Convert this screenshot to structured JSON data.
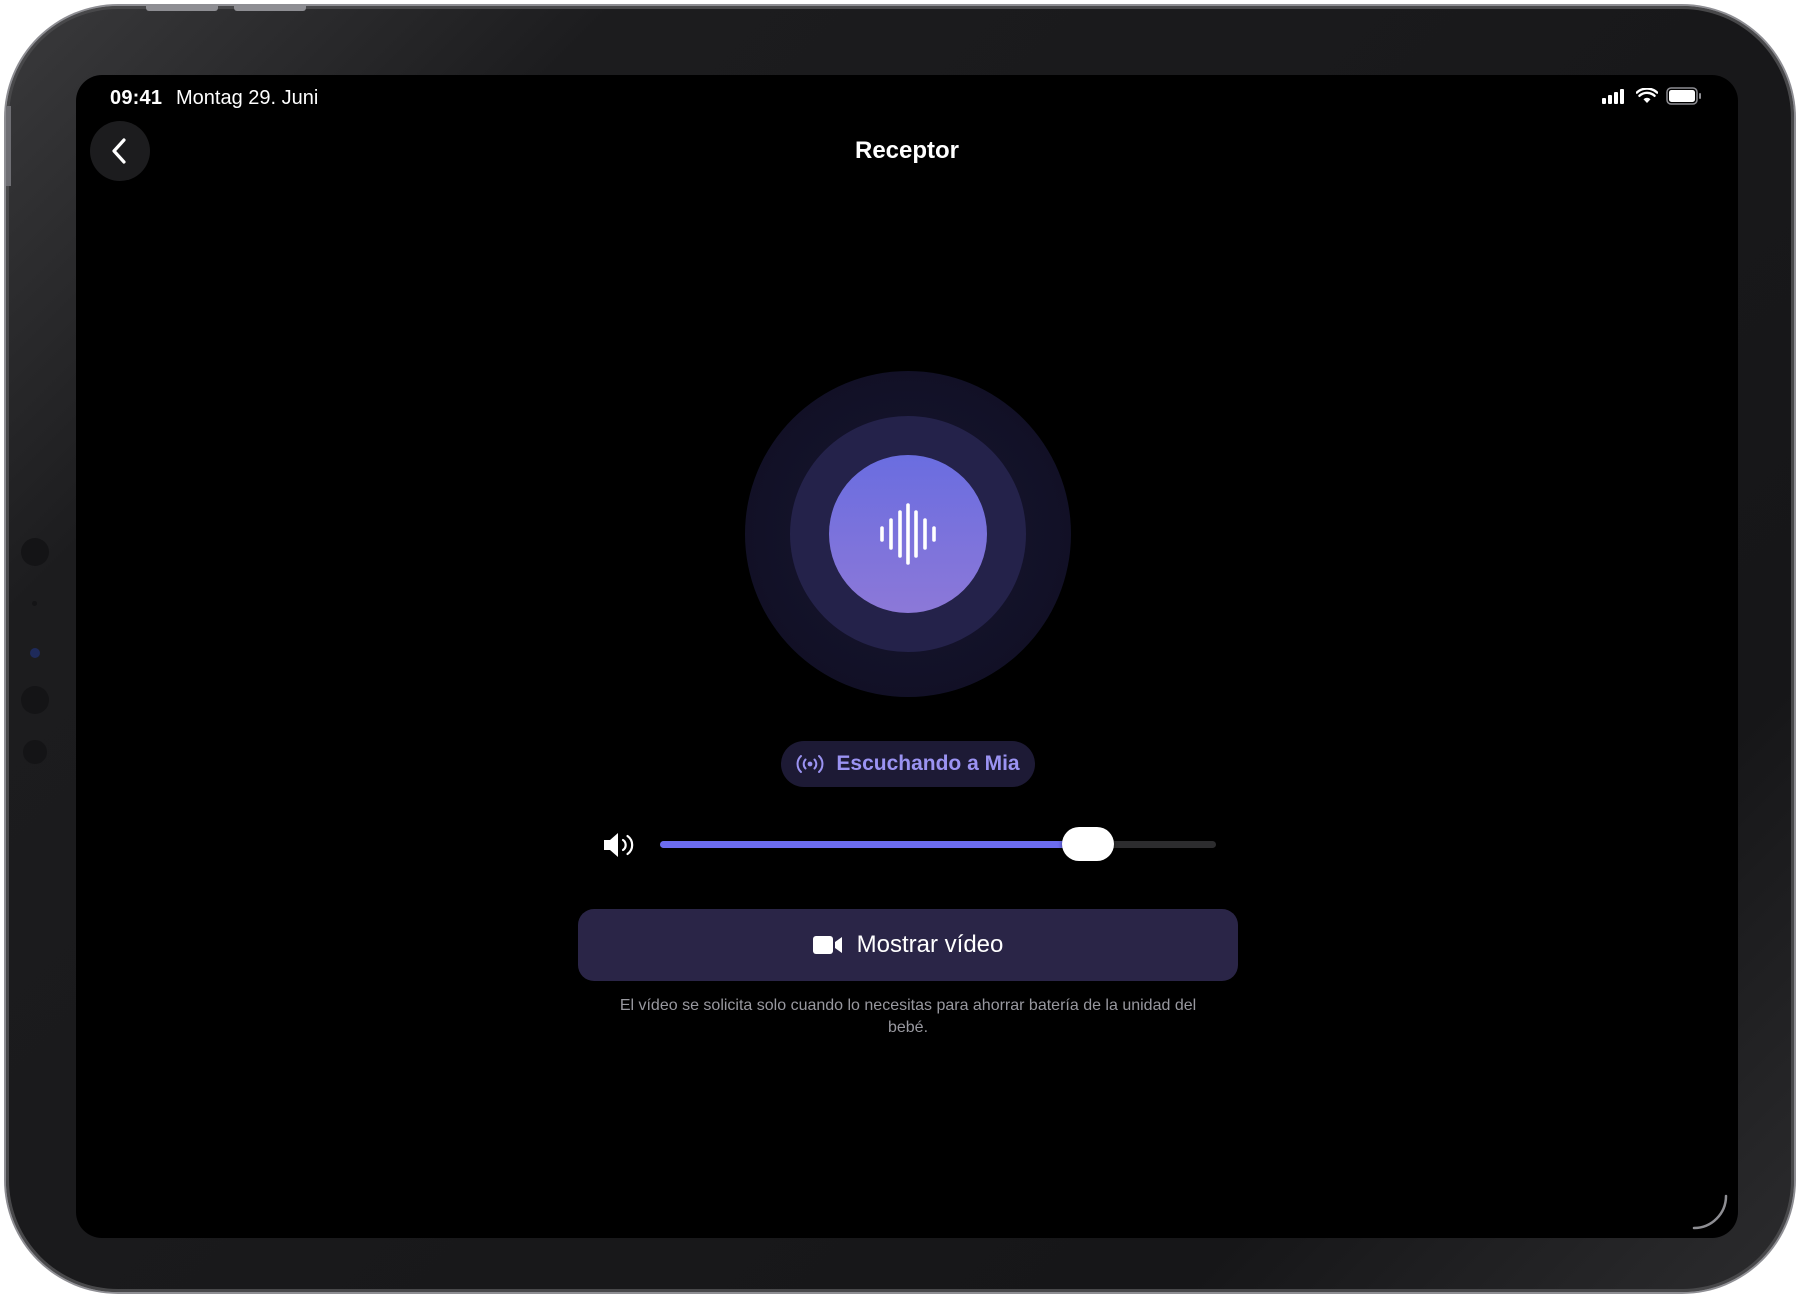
{
  "status_bar": {
    "time": "09:41",
    "date": "Montag 29. Juni",
    "icons": [
      "signal-icon",
      "wifi-icon",
      "battery-icon"
    ]
  },
  "nav": {
    "back_icon": "chevron-left-icon",
    "title": "Receptor"
  },
  "listening": {
    "icon": "waveform-icon",
    "status_icon": "broadcast-icon",
    "status_label": "Escuchando a Mia",
    "accent_color": "#7b6fe8"
  },
  "volume": {
    "icon": "speaker-icon",
    "level": 0.77
  },
  "video": {
    "icon": "video-camera-icon",
    "button_label": "Mostrar vídeo",
    "hint": "El vídeo se solicita solo cuando lo necesitas para ahorrar batería de la unidad del bebé."
  }
}
